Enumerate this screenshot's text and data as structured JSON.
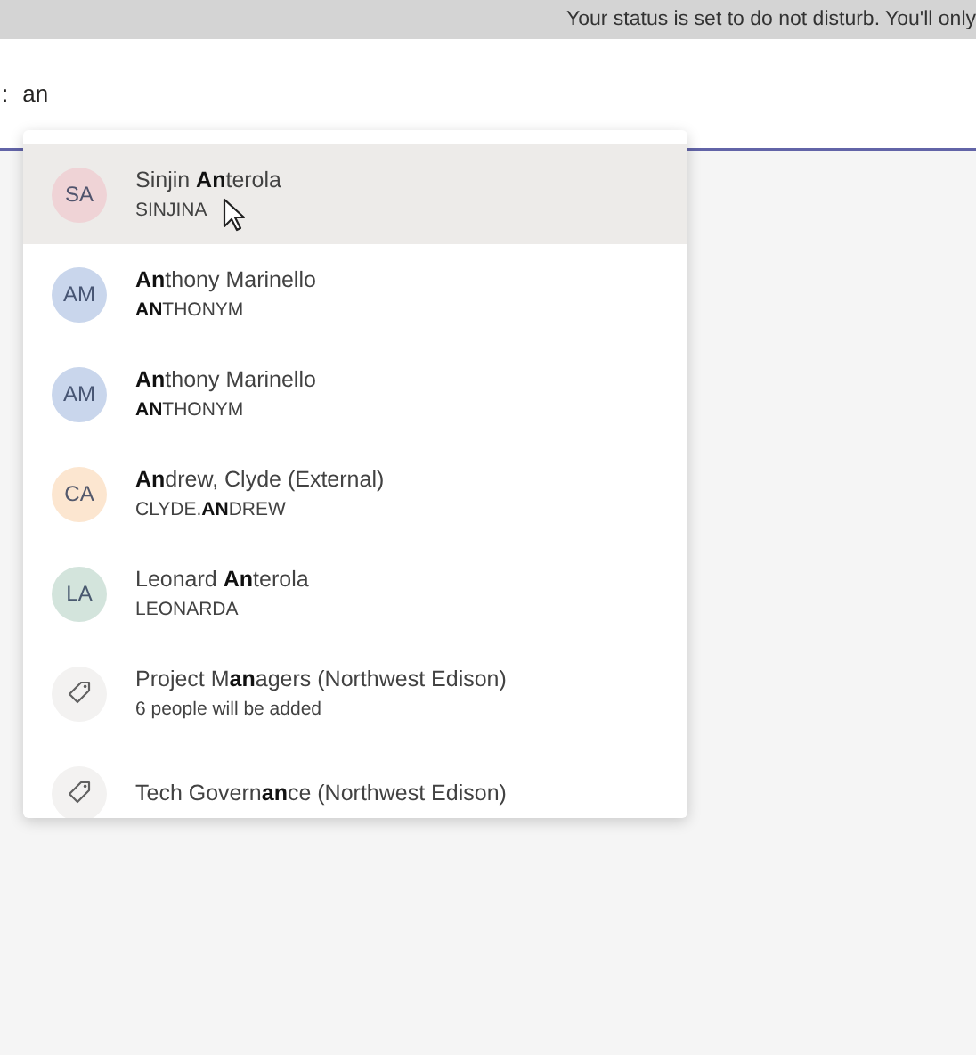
{
  "banner": {
    "text": "Your status is set to do not disturb. You'll only"
  },
  "to_field": {
    "label": ":",
    "value": "an"
  },
  "suggestions": [
    {
      "kind": "person",
      "initials": "SA",
      "color": "#efd3d6",
      "name": "Sinjin **An**terola",
      "detail": "SINJINA",
      "selected": true
    },
    {
      "kind": "person",
      "initials": "AM",
      "color": "#c9d6ec",
      "name": "**An**thony Marinello",
      "detail": "**AN**THONYM",
      "selected": false
    },
    {
      "kind": "person",
      "initials": "AM",
      "color": "#c9d6ec",
      "name": "**An**thony Marinello",
      "detail": "**AN**THONYM",
      "selected": false
    },
    {
      "kind": "person",
      "initials": "CA",
      "color": "#fce6d0",
      "name": "**An**drew, Clyde (External)",
      "detail": "CLYDE.**AN**DREW",
      "selected": false
    },
    {
      "kind": "person",
      "initials": "LA",
      "color": "#d3e4dc",
      "name": "Leonard **An**terola",
      "detail": "LEONARDA",
      "selected": false
    },
    {
      "kind": "group",
      "name": "Project M**an**agers (Northwest Edison)",
      "detail": "6 people will be added",
      "selected": false
    },
    {
      "kind": "group",
      "name": "Tech Govern**an**ce (Northwest Edison)",
      "selected": false
    }
  ]
}
